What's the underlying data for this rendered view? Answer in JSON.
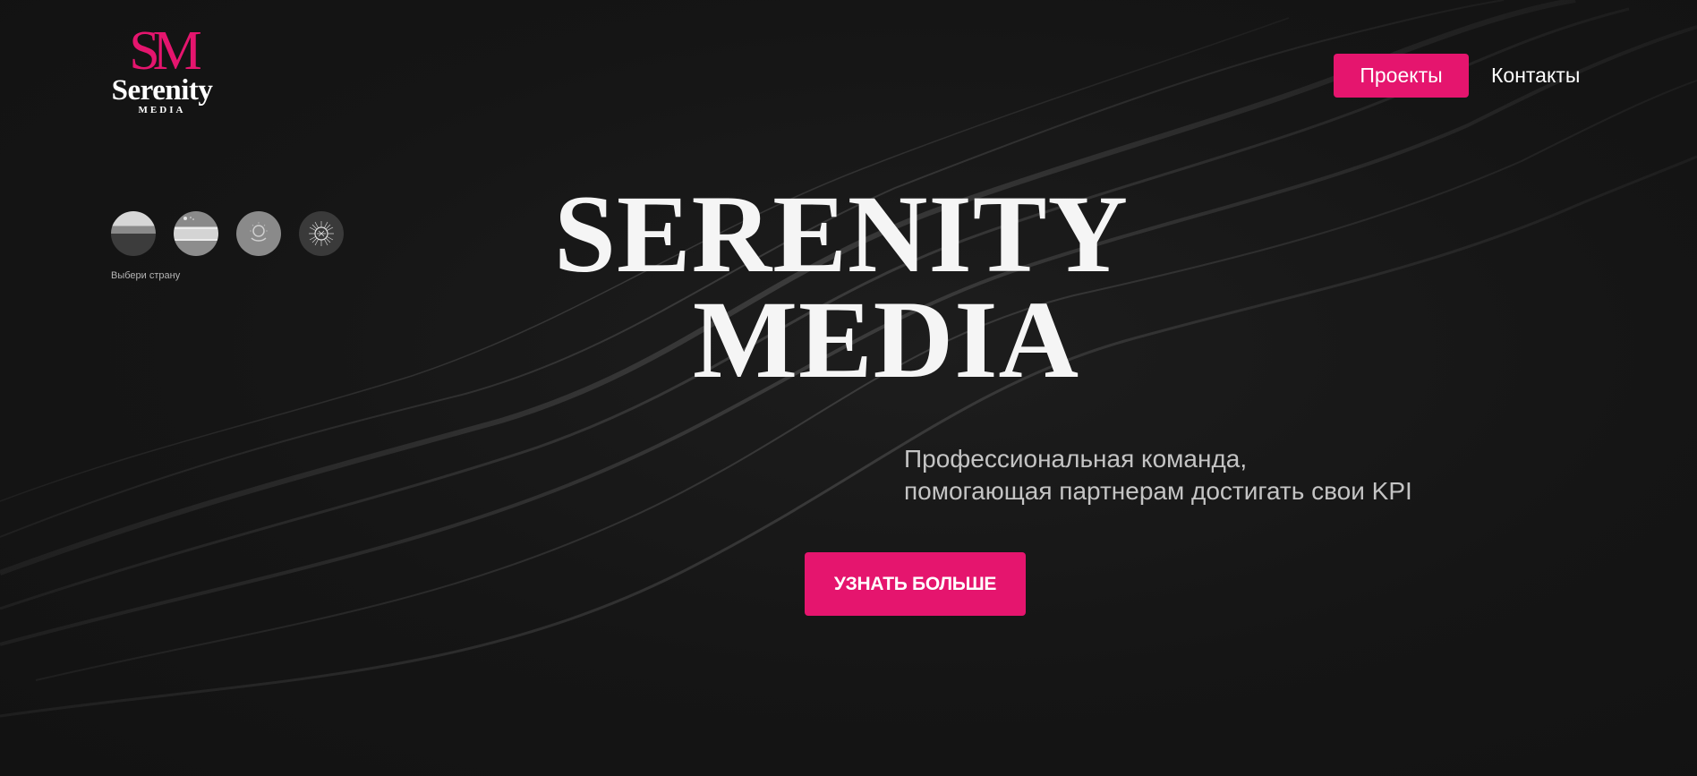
{
  "brand": {
    "logo_mark": "SM",
    "logo_word": "Serenity",
    "logo_sub": "MEDIA"
  },
  "nav": {
    "projects_label": "Проекты",
    "contacts_label": "Контакты"
  },
  "countries": {
    "label": "Выбери страну",
    "flags": [
      {
        "name": "russia-flag-icon"
      },
      {
        "name": "uzbekistan-flag-icon"
      },
      {
        "name": "kazakhstan-flag-icon"
      },
      {
        "name": "kyrgyzstan-flag-icon"
      }
    ]
  },
  "hero": {
    "title_line1": "SERENITY",
    "title_line2": "MEDIA",
    "subtitle_line1": "Профессиональная команда,",
    "subtitle_line2": "помогающая партнерам достигать свои KPI",
    "cta_label": "УЗНАТЬ БОЛЬШЕ"
  },
  "colors": {
    "accent": "#e5156e",
    "background": "#151515",
    "text": "#ffffff",
    "muted_text": "#c4c4c4"
  }
}
